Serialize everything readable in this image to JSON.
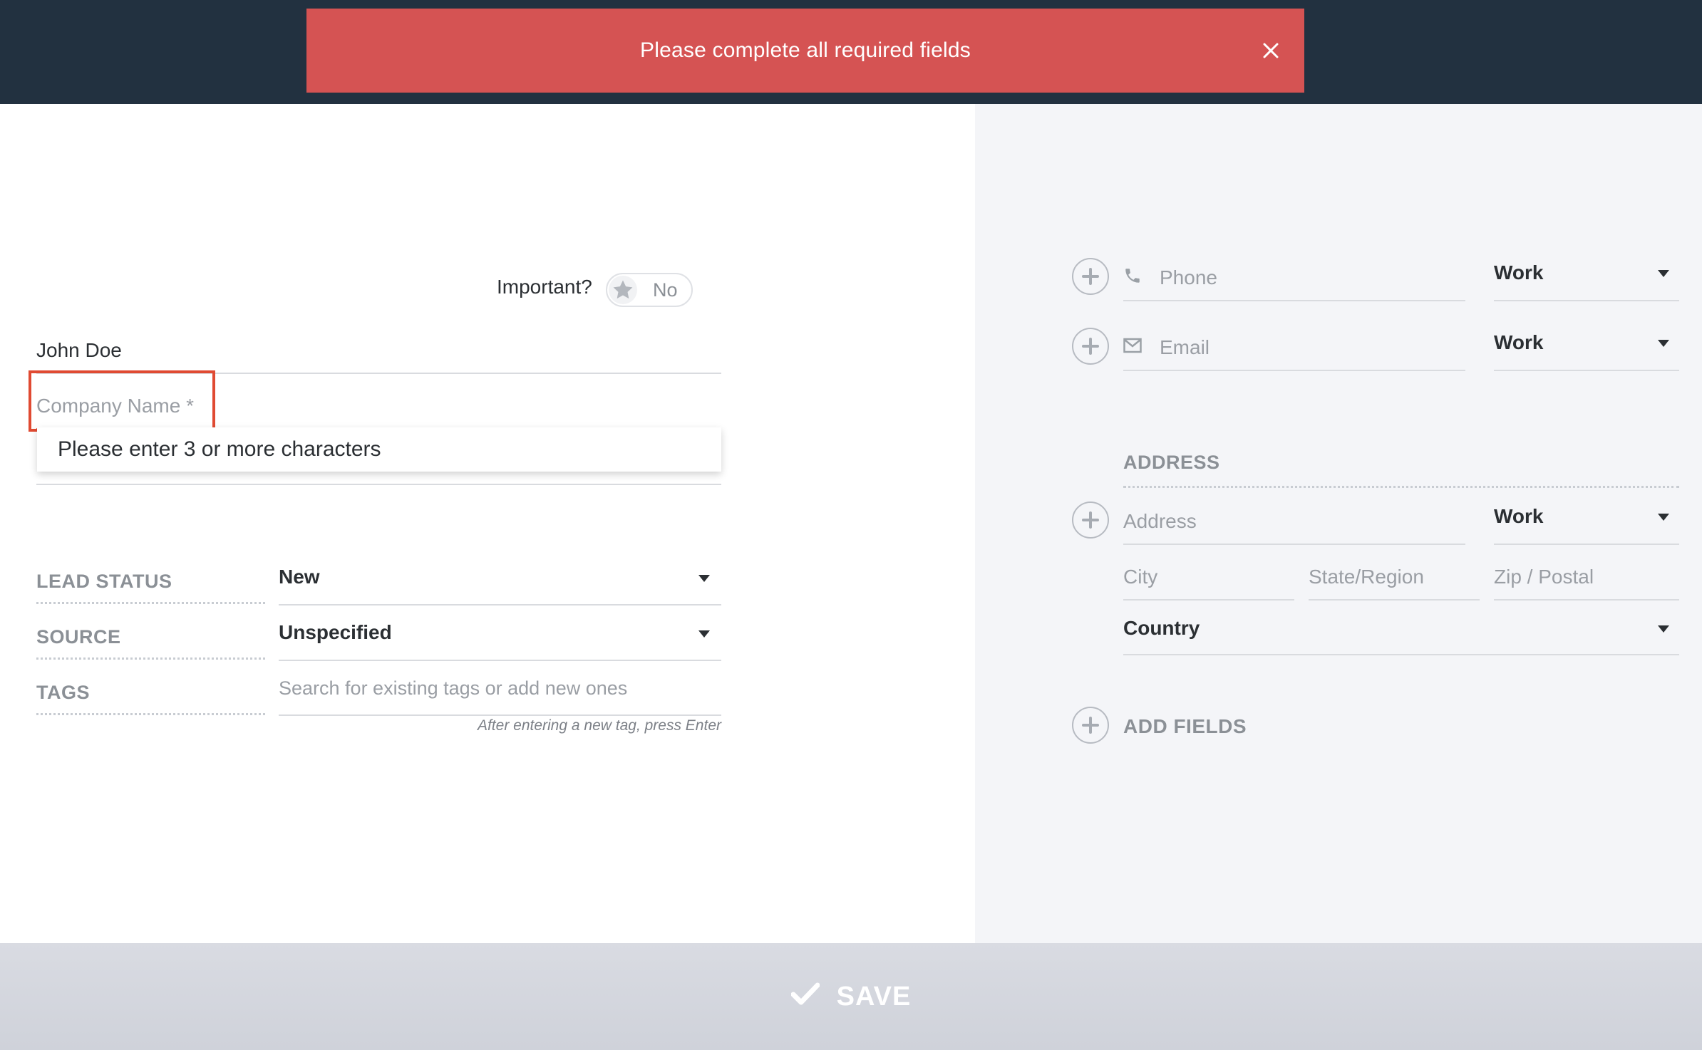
{
  "toast": {
    "message": "Please complete all required fields"
  },
  "important": {
    "label": "Important?",
    "value": "No"
  },
  "contact": {
    "name": "John Doe",
    "company_placeholder": "Company Name *",
    "company_error": "Please enter 3 or more characters"
  },
  "lead_fields": [
    {
      "label": "LEAD STATUS",
      "value": "New"
    },
    {
      "label": "SOURCE",
      "value": "Unspecified"
    },
    {
      "label": "TAGS",
      "placeholder": "Search for existing tags or add new ones",
      "hint": "After entering a new tag, press Enter"
    }
  ],
  "right": {
    "phone": {
      "placeholder": "Phone",
      "type": "Work"
    },
    "email": {
      "placeholder": "Email",
      "type": "Work"
    },
    "address_section": "ADDRESS",
    "address": {
      "placeholder": "Address",
      "type": "Work"
    },
    "city_placeholder": "City",
    "state_placeholder": "State/Region",
    "zip_placeholder": "Zip / Postal",
    "country": "Country",
    "add_fields": "ADD FIELDS"
  },
  "save": {
    "label": "SAVE"
  },
  "colors": {
    "header": "#223140",
    "toast": "#d55353",
    "error_outline": "#e04a32",
    "right_panel": "#f4f5f8"
  }
}
